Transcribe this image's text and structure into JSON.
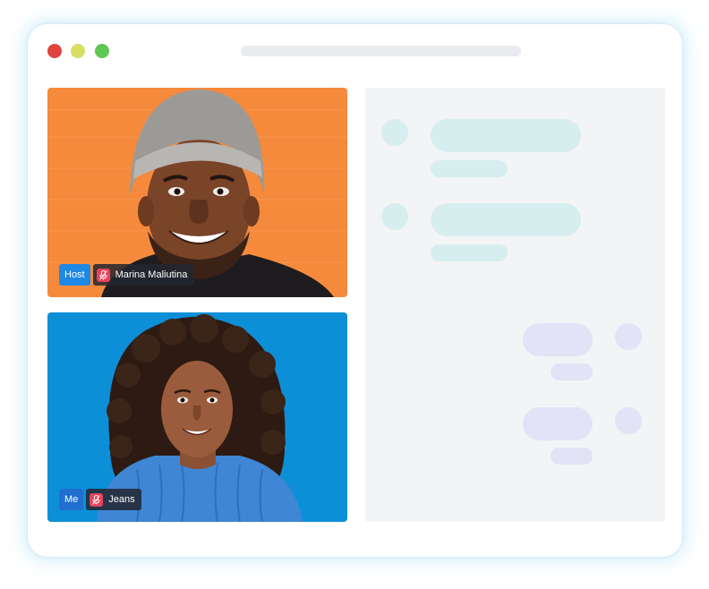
{
  "window": {
    "traffic_lights": {
      "close_color": "#e0443e",
      "minimize_color": "#d6df63",
      "maximize_color": "#5fc753"
    }
  },
  "videos": {
    "host": {
      "role": "Host",
      "name": "Marina Maliutina",
      "role_color": "#1e88e5",
      "background_color": "#f58a3c",
      "mic_icon": "mic-muted-icon"
    },
    "me": {
      "role": "Me",
      "name": "Jeans",
      "role_color": "#1e6fd0",
      "background_color": "#0d8fd8",
      "mic_icon": "mic-muted-icon"
    }
  },
  "chat": {
    "incoming_color": "#d7eeef",
    "outgoing_color": "#e3e3f7",
    "panel_color": "#f3f4f6"
  }
}
